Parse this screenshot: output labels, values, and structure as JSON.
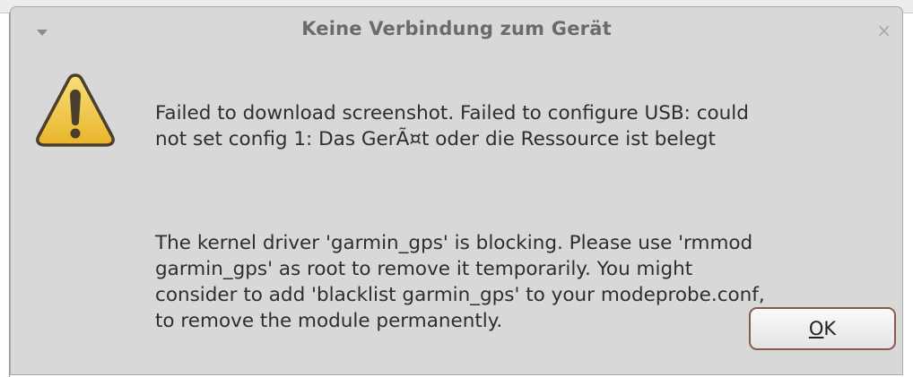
{
  "dialog": {
    "title": "Keine Verbindung zum Gerät",
    "close_glyph": "×",
    "icon": "warning-triangle-icon",
    "message_primary": "Failed to download screenshot. Failed to configure USB: could\nnot set config 1: Das GerÃ¤t oder die Ressource ist belegt",
    "message_secondary": "The kernel driver 'garmin_gps' is blocking. Please use 'rmmod\ngarmin_gps' as root to remove it temporarily. You might\nconsider to add 'blacklist garmin_gps' to your modeprobe.conf,\nto remove the module permanently.",
    "ok_mnemonic": "O",
    "ok_rest": "K"
  },
  "colors": {
    "dialog_bg": "#d8d8d8",
    "title_text": "#6b6b6b",
    "warning_fill": "#f0c43c",
    "warning_outline": "#4a3f2c",
    "button_border": "#8a5a4a"
  }
}
